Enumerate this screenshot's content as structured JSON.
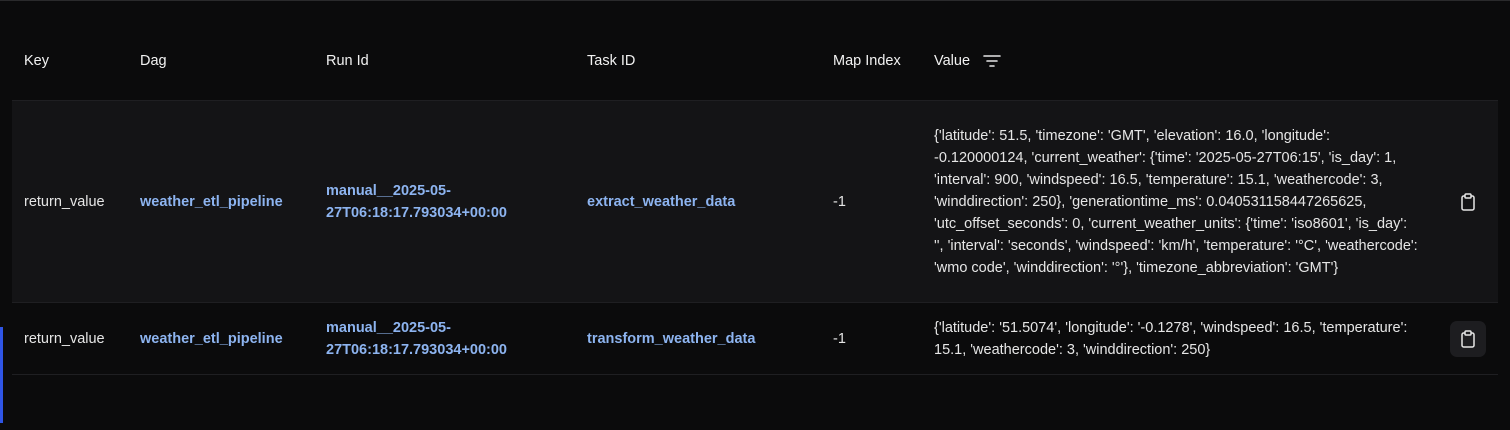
{
  "table": {
    "headers": {
      "key": "Key",
      "dag": "Dag",
      "run_id": "Run Id",
      "task_id": "Task ID",
      "map_index": "Map Index",
      "value": "Value"
    },
    "filter_icon": "filter-lines-icon",
    "rows": [
      {
        "key": "return_value",
        "dag": "weather_etl_pipeline",
        "run_id": "manual__2025-05-27T06:18:17.793034+00:00",
        "task_id": "extract_weather_data",
        "map_index": "-1",
        "value": "{'latitude': 51.5, 'timezone': 'GMT', 'elevation': 16.0, 'longitude': -0.120000124, 'current_weather': {'time': '2025-05-27T06:15', 'is_day': 1, 'interval': 900, 'windspeed': 16.5, 'temperature': 15.1, 'weathercode': 3, 'winddirection': 250}, 'generationtime_ms': 0.040531158447265625, 'utc_offset_seconds': 0, 'current_weather_units': {'time': 'iso8601', 'is_day': '', 'interval': 'seconds', 'windspeed': 'km/h', 'temperature': '°C', 'weathercode': 'wmo code', 'winddirection': '°'}, 'timezone_abbreviation': 'GMT'}",
        "copy_icon": "clipboard-icon"
      },
      {
        "key": "return_value",
        "dag": "weather_etl_pipeline",
        "run_id": "manual__2025-05-27T06:18:17.793034+00:00",
        "task_id": "transform_weather_data",
        "map_index": "-1",
        "value": "{'latitude': '51.5074', 'longitude': '-0.1278', 'windspeed': 16.5, 'temperature': 15.1, 'weathercode': 3, 'winddirection': 250}",
        "copy_icon": "clipboard-icon"
      }
    ]
  },
  "colors": {
    "background": "#0b0b0c",
    "row_highlight": "#141416",
    "link": "#8db4f0",
    "accent": "#2f55e6"
  }
}
